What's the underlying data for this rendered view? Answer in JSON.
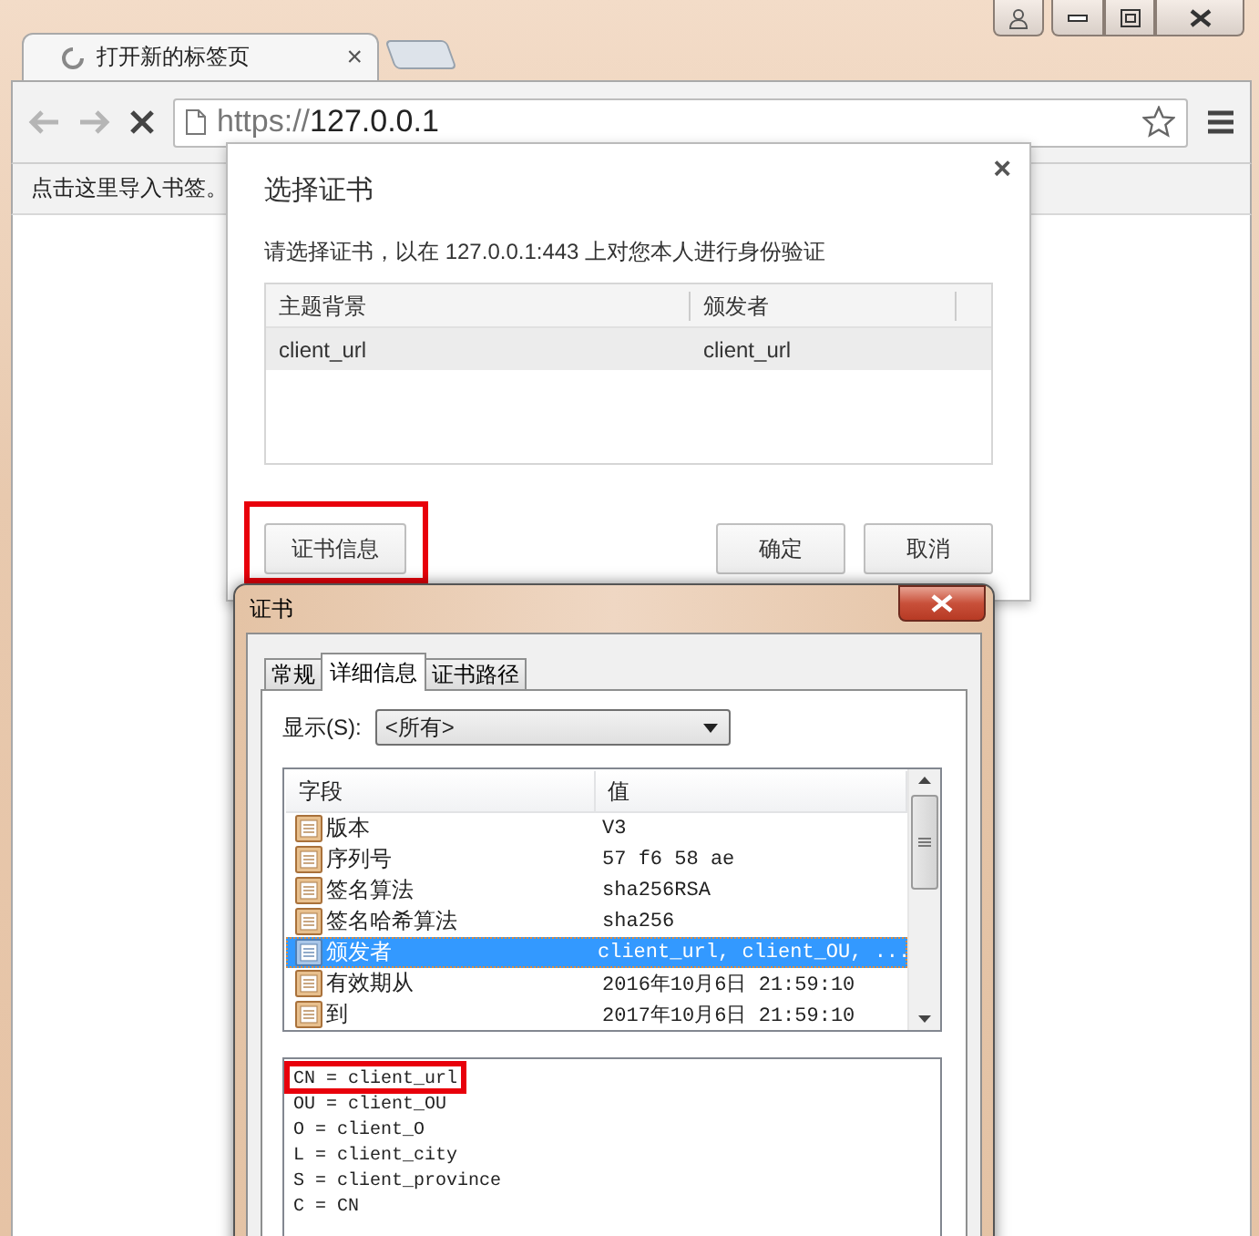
{
  "browser": {
    "tab": {
      "title": "打开新的标签页",
      "loading": true,
      "close": "×"
    },
    "url": {
      "scheme": "https://",
      "host": "127.0.0.1"
    },
    "bookmark_hint": "点击这里导入书签。"
  },
  "select_dialog": {
    "title": "选择证书",
    "close": "×",
    "prompt": "请选择证书，以在 127.0.0.1:443 上对您本人进行身份验证",
    "columns": [
      "主题背景",
      "颁发者"
    ],
    "rows": [
      {
        "cells": [
          "client_url",
          "client_url"
        ],
        "selected": true
      }
    ],
    "buttons": [
      {
        "label": "证书信息",
        "highlighted": true
      },
      {
        "label": "确定",
        "highlighted": false
      },
      {
        "label": "取消",
        "highlighted": false
      }
    ]
  },
  "cert_window": {
    "title": "证书",
    "tabs": [
      {
        "label": "常规",
        "selected": false
      },
      {
        "label": "详细信息",
        "selected": true
      },
      {
        "label": "证书路径",
        "selected": false
      }
    ],
    "show_label": "显示(S):",
    "show_value": "<所有>",
    "columns": [
      "字段",
      "值"
    ],
    "fields": [
      {
        "field": "版本",
        "value": "V3",
        "selected": false
      },
      {
        "field": "序列号",
        "value": "57 f6 58 ae",
        "selected": false
      },
      {
        "field": "签名算法",
        "value": "sha256RSA",
        "selected": false
      },
      {
        "field": "签名哈希算法",
        "value": "sha256",
        "selected": false
      },
      {
        "field": "颁发者",
        "value": "client_url, client_OU, ...",
        "selected": true
      },
      {
        "field": "有效期从",
        "value": "2016年10月6日 21:59:10",
        "selected": false
      },
      {
        "field": "到",
        "value": "2017年10月6日 21:59:10",
        "selected": false
      }
    ],
    "details": [
      {
        "text": "CN = client_url",
        "highlighted": true
      },
      {
        "text": "OU = client_OU",
        "highlighted": false
      },
      {
        "text": "O = client_O",
        "highlighted": false
      },
      {
        "text": "L = client_city",
        "highlighted": false
      },
      {
        "text": "S = client_province",
        "highlighted": false
      },
      {
        "text": "C = CN",
        "highlighted": false
      }
    ]
  }
}
